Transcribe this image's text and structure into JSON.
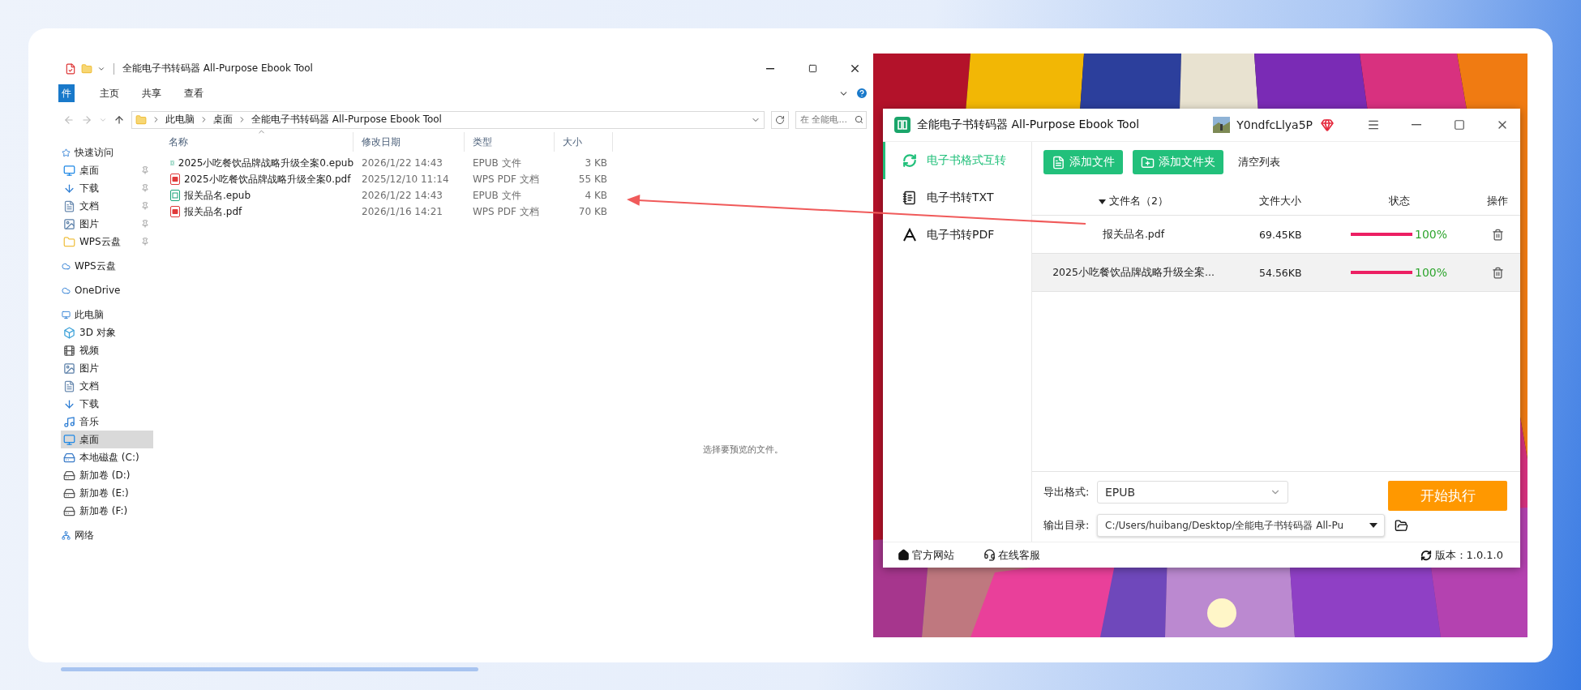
{
  "explorer": {
    "title": "全能电子书转码器 All-Purpose Ebook Tool",
    "ribbon_tabs": [
      {
        "label": "件",
        "selected": true
      },
      {
        "label": "主页",
        "selected": false
      },
      {
        "label": "共享",
        "selected": false
      },
      {
        "label": "查看",
        "selected": false
      }
    ],
    "breadcrumbs": [
      "此电脑",
      "桌面",
      "全能电子书转码器 All-Purpose Ebook Tool"
    ],
    "search": {
      "placeholder": "在 全能电..."
    },
    "nav": [
      {
        "label": "快速访问",
        "kind": "star",
        "selected": false,
        "children": [
          {
            "label": "桌面",
            "kind": "desktop",
            "pinned": true,
            "selected": false
          },
          {
            "label": "下载",
            "kind": "download",
            "pinned": true,
            "selected": false
          },
          {
            "label": "文档",
            "kind": "document",
            "pinned": true,
            "selected": false
          },
          {
            "label": "图片",
            "kind": "picture",
            "pinned": true,
            "selected": false
          },
          {
            "label": "WPS云盘",
            "kind": "folder",
            "pinned": true,
            "selected": false
          }
        ]
      },
      {
        "label": "WPS云盘",
        "kind": "cloud",
        "selected": false
      },
      {
        "label": "OneDrive",
        "kind": "cloud",
        "selected": false
      },
      {
        "label": "此电脑",
        "kind": "pc",
        "selected": false,
        "children": [
          {
            "label": "3D 对象",
            "kind": "cube",
            "pinned": false,
            "selected": false
          },
          {
            "label": "视频",
            "kind": "video",
            "pinned": false,
            "selected": false
          },
          {
            "label": "图片",
            "kind": "picture",
            "pinned": false,
            "selected": false
          },
          {
            "label": "文档",
            "kind": "document",
            "pinned": false,
            "selected": false
          },
          {
            "label": "下载",
            "kind": "download",
            "pinned": false,
            "selected": false
          },
          {
            "label": "音乐",
            "kind": "music",
            "pinned": false,
            "selected": false
          },
          {
            "label": "桌面",
            "kind": "desktop",
            "pinned": false,
            "selected": true
          },
          {
            "label": "本地磁盘 (C:)",
            "kind": "system-drive",
            "pinned": false,
            "selected": false
          },
          {
            "label": "新加卷 (D:)",
            "kind": "drive",
            "pinned": false,
            "selected": false
          },
          {
            "label": "新加卷 (E:)",
            "kind": "drive",
            "pinned": false,
            "selected": false
          },
          {
            "label": "新加卷 (F:)",
            "kind": "drive",
            "pinned": false,
            "selected": false
          }
        ]
      },
      {
        "label": "网络",
        "kind": "network",
        "selected": false
      }
    ],
    "columns": [
      {
        "label": "名称",
        "sorted": true
      },
      {
        "label": "修改日期",
        "sorted": false
      },
      {
        "label": "类型",
        "sorted": false
      },
      {
        "label": "大小",
        "sorted": false
      }
    ],
    "files": [
      {
        "name": "2025小吃餐饮品牌战略升级全案0.epub",
        "date": "2026/1/22 14:43",
        "type": "EPUB 文件",
        "size": "3 KB",
        "kind": "epub"
      },
      {
        "name": "2025小吃餐饮品牌战略升级全案0.pdf",
        "date": "2025/12/10 11:14",
        "type": "WPS PDF 文档",
        "size": "55 KB",
        "kind": "pdf"
      },
      {
        "name": "报关品名.epub",
        "date": "2026/1/22 14:43",
        "type": "EPUB 文件",
        "size": "4 KB",
        "kind": "epub"
      },
      {
        "name": "报关品名.pdf",
        "date": "2026/1/16 14:21",
        "type": "WPS PDF 文档",
        "size": "70 KB",
        "kind": "pdf"
      }
    ],
    "preview_hint": "选择要预览的文件。"
  },
  "app": {
    "title": "全能电子书转码器 All-Purpose Ebook Tool",
    "user": {
      "name": "Y0ndfcLlya5P"
    },
    "nav": [
      {
        "label": "电子书格式互转",
        "kind": "convert",
        "selected": true
      },
      {
        "label": "电子书转TXT",
        "kind": "txt",
        "selected": false
      },
      {
        "label": "电子书转PDF",
        "kind": "pdf",
        "selected": false
      }
    ],
    "toolbar": [
      {
        "label": "添加文件",
        "kind": "add-file"
      },
      {
        "label": "添加文件夹",
        "kind": "add-folder"
      },
      {
        "label": "清空列表",
        "kind": "link"
      }
    ],
    "columns": [
      {
        "label": "文件名（2）",
        "sorted": true
      },
      {
        "label": "文件大小",
        "sorted": false
      },
      {
        "label": "状态",
        "sorted": false
      },
      {
        "label": "操作",
        "sorted": false
      }
    ],
    "rows": [
      {
        "name": "报关品名.pdf",
        "size": "69.45KB",
        "level": 1,
        "percent": "100%",
        "selected": false
      },
      {
        "name": "2025小吃餐饮品牌战略升级全案...",
        "size": "54.56KB",
        "level": 1,
        "percent": "100%",
        "selected": true
      }
    ],
    "export_format": {
      "label": "导出格式:",
      "value": "EPUB"
    },
    "output_dir": {
      "label": "输出目录:",
      "value": "C:/Users/huibang/Desktop/全能电子书转码器 All-Pu"
    },
    "start_button": "开始执行",
    "footer": {
      "links": [
        {
          "label": "官方网站",
          "kind": "home"
        },
        {
          "label": "在线客服",
          "kind": "support"
        }
      ],
      "version": "版本：1.0.1.0"
    }
  }
}
